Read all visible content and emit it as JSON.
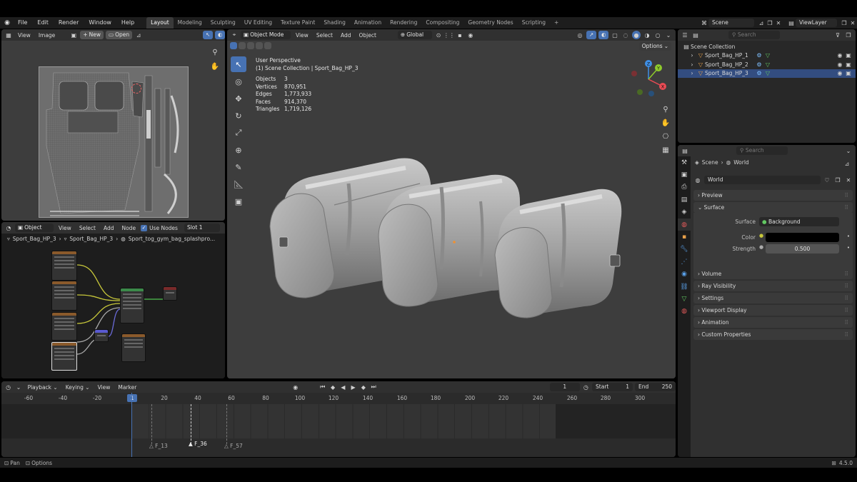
{
  "topbar": {
    "menus": [
      "File",
      "Edit",
      "Render",
      "Window",
      "Help"
    ],
    "workspaces": [
      "Layout",
      "Modeling",
      "Sculpting",
      "UV Editing",
      "Texture Paint",
      "Shading",
      "Animation",
      "Rendering",
      "Compositing",
      "Geometry Nodes",
      "Scripting"
    ],
    "active_workspace": "Layout",
    "add_tab": "+",
    "scene": "Scene",
    "view_layer": "ViewLayer"
  },
  "uv_editor": {
    "menus": [
      "View",
      "Image"
    ],
    "new_label": "New",
    "open_label": "Open"
  },
  "node_editor": {
    "object_mode": "Object",
    "menus": [
      "View",
      "Select",
      "Add",
      "Node"
    ],
    "use_nodes_label": "Use Nodes",
    "use_nodes_checked": true,
    "slot": "Slot 1",
    "breadcrumbs": [
      "Sport_Bag_HP_3",
      "Sport_Bag_HP_3",
      "Sport_tog_gym_bag_splashpro..."
    ]
  },
  "viewport": {
    "mode": "Object Mode",
    "menus": [
      "View",
      "Select",
      "Add",
      "Object"
    ],
    "transform": "Global",
    "options_label": "Options",
    "perspective": "User Perspective",
    "collection_line": "(1) Scene Collection | Sport_Bag_HP_3",
    "stats": [
      {
        "label": "Objects",
        "value": "3"
      },
      {
        "label": "Vertices",
        "value": "870,951"
      },
      {
        "label": "Edges",
        "value": "1,773,933"
      },
      {
        "label": "Faces",
        "value": "914,370"
      },
      {
        "label": "Triangles",
        "value": "1,719,126"
      }
    ],
    "gizmo_axes": {
      "x": "X",
      "y": "Y",
      "z": "Z"
    },
    "colors": {
      "x": "#e94b54",
      "y": "#8fcb2c",
      "z": "#3f8fe6"
    }
  },
  "outliner": {
    "search_placeholder": "Search",
    "root": "Scene Collection",
    "items": [
      "Sport_Bag_HP_1",
      "Sport_Bag_HP_2",
      "Sport_Bag_HP_3"
    ]
  },
  "properties": {
    "search_placeholder": "Search",
    "breadcrumb_scene": "Scene",
    "breadcrumb_world": "World",
    "world_name": "World",
    "sections": {
      "preview": "Preview",
      "surface": "Surface",
      "volume": "Volume",
      "ray_visibility": "Ray Visibility",
      "settings": "Settings",
      "viewport_display": "Viewport Display",
      "animation": "Animation",
      "custom_properties": "Custom Properties"
    },
    "surface_label": "Surface",
    "surface_value": "Background",
    "color_label": "Color",
    "strength_label": "Strength",
    "strength_value": "0.500"
  },
  "timeline": {
    "menus": [
      "Playback",
      "Keying",
      "View",
      "Marker"
    ],
    "current_frame": "1",
    "start_label": "Start",
    "start_value": "1",
    "end_label": "End",
    "end_value": "250",
    "ticks": [
      "-60",
      "-40",
      "-20",
      "20",
      "40",
      "60",
      "80",
      "100",
      "120",
      "140",
      "160",
      "180",
      "200",
      "220",
      "240",
      "260",
      "280",
      "300"
    ],
    "playhead": "1",
    "markers": [
      "F_13",
      "F_36",
      "F_57"
    ]
  },
  "statusbar": {
    "pan_label": "Pan",
    "options_label": "Options",
    "version": "4.5.0"
  }
}
